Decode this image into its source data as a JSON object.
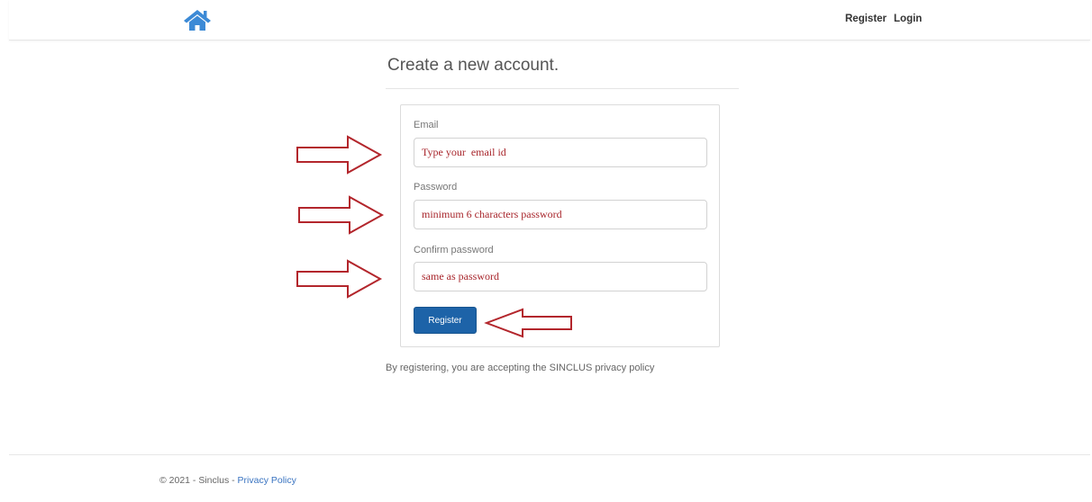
{
  "navbar": {
    "home_icon": "home-icon",
    "brand_color": "#3c8ad6",
    "register_label": "Register",
    "login_label": "Login"
  },
  "main": {
    "title": "Create a new account.",
    "form": {
      "email_label": "Email",
      "email_value": "Type your  email id",
      "password_label": "Password",
      "password_value": "minimum 6 characters password",
      "confirm_label": "Confirm password",
      "confirm_value": "same as password",
      "submit_label": "Register"
    },
    "policy_note": "By registering, you are accepting the SINCLUS privacy policy"
  },
  "annotations": {
    "arrow_color": "#b3262c",
    "input_text_color": "#a8262c"
  },
  "footer": {
    "copyright": "© 2021 - Sinclus - ",
    "privacy_link": "Privacy Policy"
  },
  "colors": {
    "button_bg": "#1d63a8",
    "link": "#3a74c1"
  }
}
